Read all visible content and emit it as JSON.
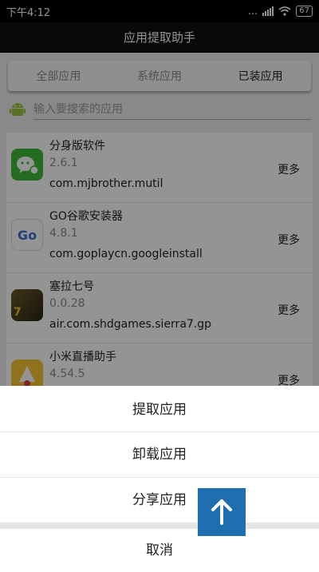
{
  "statusbar": {
    "time": "下午4:12",
    "signal_dots": "...",
    "battery": "67"
  },
  "header": {
    "title": "应用提取助手"
  },
  "tabs": [
    {
      "label": "全部应用",
      "active": false
    },
    {
      "label": "系统应用",
      "active": false
    },
    {
      "label": "已装应用",
      "active": true
    }
  ],
  "search": {
    "placeholder": "输入要搜索的应用"
  },
  "apps": [
    {
      "name": "分身版软件",
      "version": "2.6.1",
      "package": "com.mjbrother.mutil",
      "more": "更多"
    },
    {
      "name": "GO谷歌安装器",
      "version": "4.8.1",
      "package": "com.goplaycn.googleinstall",
      "more": "更多"
    },
    {
      "name": "塞拉七号",
      "version": "0.0.28",
      "package": "air.com.shdgames.sierra7.gp",
      "more": "更多"
    },
    {
      "name": "小米直播助手",
      "version": "4.54.5",
      "package": "",
      "more": "更多"
    }
  ],
  "icon_labels": {
    "go": "Go",
    "sierra": "7"
  },
  "sheet": {
    "extract": "提取应用",
    "uninstall": "卸载应用",
    "share": "分享应用",
    "cancel": "取消"
  },
  "colors": {
    "fab": "#1f6fb0",
    "android_green": "#9bc53d",
    "wechat_green": "#3fba3a"
  }
}
